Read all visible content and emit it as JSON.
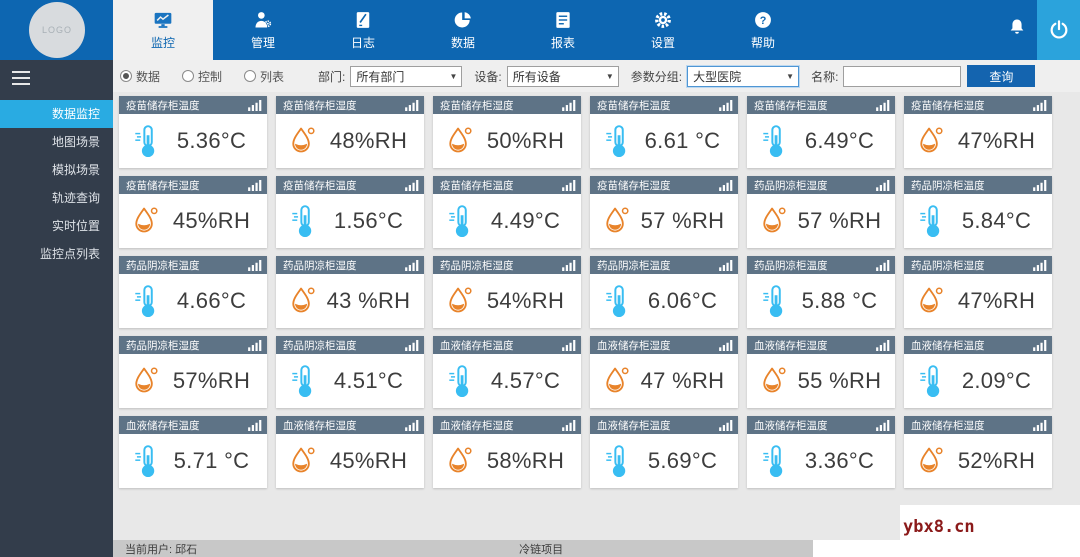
{
  "topbar": {
    "logo_text": "LOGO",
    "tabs": [
      {
        "label": "监控",
        "icon": "monitor",
        "active": true
      },
      {
        "label": "管理",
        "icon": "usergear",
        "active": false
      },
      {
        "label": "日志",
        "icon": "journal",
        "active": false
      },
      {
        "label": "数据",
        "icon": "pie",
        "active": false
      },
      {
        "label": "报表",
        "icon": "report",
        "active": false
      },
      {
        "label": "设置",
        "icon": "gear",
        "active": false
      },
      {
        "label": "帮助",
        "icon": "help",
        "active": false
      }
    ]
  },
  "sidebar": {
    "items": [
      {
        "label": "数据监控",
        "active": true
      },
      {
        "label": "地图场景",
        "active": false
      },
      {
        "label": "模拟场景",
        "active": false
      },
      {
        "label": "轨迹查询",
        "active": false
      },
      {
        "label": "实时位置",
        "active": false
      },
      {
        "label": "监控点列表",
        "active": false
      }
    ]
  },
  "filters": {
    "radios": [
      {
        "label": "数据",
        "selected": true
      },
      {
        "label": "控制",
        "selected": false
      },
      {
        "label": "列表",
        "selected": false
      }
    ],
    "department_label": "部门:",
    "department_value": "所有部门",
    "device_label": "设备:",
    "device_value": "所有设备",
    "group_label": "参数分组:",
    "group_value": "大型医院",
    "name_label": "名称:",
    "name_value": "",
    "search_label": "查询"
  },
  "cards": [
    {
      "title": "疫苗储存柜温度",
      "value": "5.36°C",
      "type": "temp"
    },
    {
      "title": "疫苗储存柜湿度",
      "value": "48%RH",
      "type": "hum"
    },
    {
      "title": "疫苗储存柜湿度",
      "value": "50%RH",
      "type": "hum"
    },
    {
      "title": "疫苗储存柜温度",
      "value": "6.61 °C",
      "type": "temp"
    },
    {
      "title": "疫苗储存柜温度",
      "value": "6.49°C",
      "type": "temp"
    },
    {
      "title": "疫苗储存柜湿度",
      "value": "47%RH",
      "type": "hum"
    },
    {
      "title": "疫苗储存柜湿度",
      "value": "45%RH",
      "type": "hum"
    },
    {
      "title": "疫苗储存柜温度",
      "value": "1.56°C",
      "type": "temp"
    },
    {
      "title": "疫苗储存柜温度",
      "value": "4.49°C",
      "type": "temp"
    },
    {
      "title": "疫苗储存柜湿度",
      "value": "57 %RH",
      "type": "hum"
    },
    {
      "title": "药品阴凉柜湿度",
      "value": "57 %RH",
      "type": "hum"
    },
    {
      "title": "药品阴凉柜温度",
      "value": "5.84°C",
      "type": "temp"
    },
    {
      "title": "药品阴凉柜温度",
      "value": "4.66°C",
      "type": "temp"
    },
    {
      "title": "药品阴凉柜湿度",
      "value": "43 %RH",
      "type": "hum"
    },
    {
      "title": "药品阴凉柜湿度",
      "value": "54%RH",
      "type": "hum"
    },
    {
      "title": "药品阴凉柜温度",
      "value": "6.06°C",
      "type": "temp"
    },
    {
      "title": "药品阴凉柜温度",
      "value": "5.88 °C",
      "type": "temp"
    },
    {
      "title": "药品阴凉柜湿度",
      "value": "47%RH",
      "type": "hum"
    },
    {
      "title": "药品阴凉柜湿度",
      "value": "57%RH",
      "type": "hum"
    },
    {
      "title": "药品阴凉柜温度",
      "value": "4.51°C",
      "type": "temp"
    },
    {
      "title": "血液储存柜温度",
      "value": "4.57°C",
      "type": "temp"
    },
    {
      "title": "血液储存柜湿度",
      "value": "47 %RH",
      "type": "hum"
    },
    {
      "title": "血液储存柜湿度",
      "value": "55 %RH",
      "type": "hum"
    },
    {
      "title": "血液储存柜温度",
      "value": "2.09°C",
      "type": "temp"
    },
    {
      "title": "血液储存柜温度",
      "value": "5.71 °C",
      "type": "temp"
    },
    {
      "title": "血液储存柜湿度",
      "value": "45%RH",
      "type": "hum"
    },
    {
      "title": "血液储存柜湿度",
      "value": "58%RH",
      "type": "hum"
    },
    {
      "title": "血液储存柜温度",
      "value": "5.69°C",
      "type": "temp"
    },
    {
      "title": "血液储存柜温度",
      "value": "3.36°C",
      "type": "temp"
    },
    {
      "title": "血液储存柜湿度",
      "value": "52%RH",
      "type": "hum"
    }
  ],
  "statusbar": {
    "user": "当前用户: 邱石",
    "project": "冷链项目"
  },
  "watermark": "ybx8.cn",
  "colors": {
    "nav_blue": "#0d66b1",
    "power_blue": "#2ba3dc",
    "sidebar_dark": "#333d4b",
    "sidebar_active": "#29abe2",
    "card_header": "#5e7386",
    "temp_icon": "#38bdf2",
    "humidity_icon": "#e8832a",
    "button_blue": "#1464af"
  }
}
